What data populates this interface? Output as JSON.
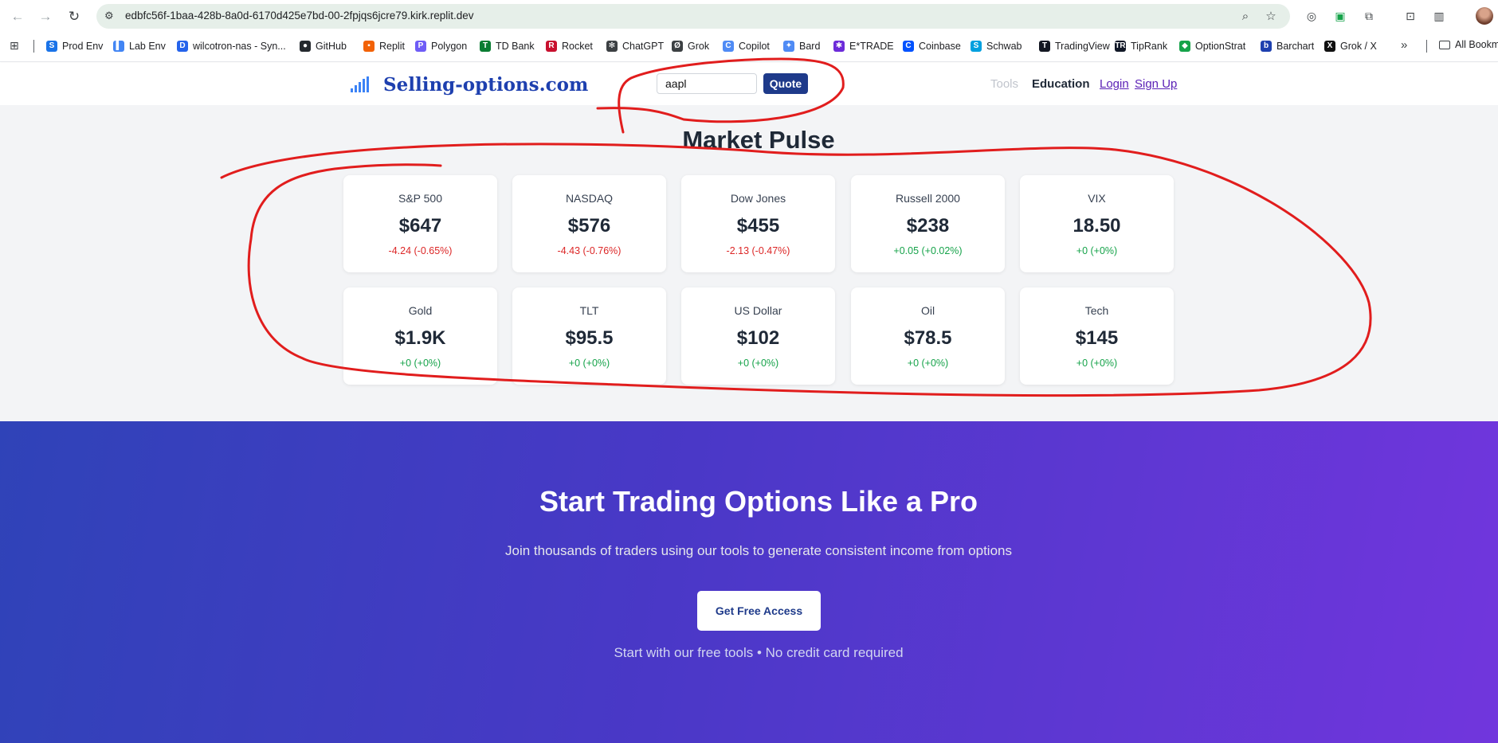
{
  "browser": {
    "url": "edbfc56f-1baa-428b-8a0d-6170d425e7bd-00-2fpjqs6jcre79.kirk.replit.dev",
    "bookmarks": [
      {
        "label": "Prod Env",
        "color": "#1a73e8",
        "glyph": "S"
      },
      {
        "label": "Lab Env",
        "color": "#4285f4",
        "glyph": "▌"
      },
      {
        "label": "wilcotron-nas - Syn...",
        "color": "#2563eb",
        "glyph": "D"
      },
      {
        "label": "GitHub",
        "color": "#24292e",
        "glyph": "●"
      },
      {
        "label": "Replit",
        "color": "#f26207",
        "glyph": "▪"
      },
      {
        "label": "Polygon",
        "color": "#6e5cf6",
        "glyph": "P"
      },
      {
        "label": "TD Bank",
        "color": "#0a7d32",
        "glyph": "T"
      },
      {
        "label": "Rocket",
        "color": "#c8102e",
        "glyph": "R"
      },
      {
        "label": "ChatGPT",
        "color": "#3c4043",
        "glyph": "✻"
      },
      {
        "label": "Grok",
        "color": "#3c4043",
        "glyph": "Ø"
      },
      {
        "label": "Copilot",
        "color": "#4f8bf5",
        "glyph": "C"
      },
      {
        "label": "Bard",
        "color": "#4f8bf5",
        "glyph": "✦"
      },
      {
        "label": "E*TRADE",
        "color": "#6c2bd9",
        "glyph": "✱"
      },
      {
        "label": "Coinbase",
        "color": "#0052ff",
        "glyph": "C"
      },
      {
        "label": "Schwab",
        "color": "#00a0df",
        "glyph": "S"
      },
      {
        "label": "TradingView",
        "color": "#131722",
        "glyph": "T"
      },
      {
        "label": "TipRank",
        "color": "#111827",
        "glyph": "TR"
      },
      {
        "label": "OptionStrat",
        "color": "#16a34a",
        "glyph": "◆"
      },
      {
        "label": "Barchart",
        "color": "#1e40af",
        "glyph": "b"
      },
      {
        "label": "Grok / X",
        "color": "#111111",
        "glyph": "X"
      }
    ],
    "bookmark_folder": "All Bookm",
    "more_bookmarks": "»"
  },
  "header": {
    "logo_text": "Selling-options.com",
    "search_value": "aapl",
    "quote_label": "Quote",
    "nav": {
      "tools": "Tools",
      "education": "Education",
      "login": "Login",
      "signup": "Sign Up"
    }
  },
  "market": {
    "title": "Market Pulse",
    "cards": [
      {
        "name": "S&P 500",
        "value": "$647",
        "change": "-4.24 (-0.65%)",
        "dir": "neg"
      },
      {
        "name": "NASDAQ",
        "value": "$576",
        "change": "-4.43 (-0.76%)",
        "dir": "neg"
      },
      {
        "name": "Dow Jones",
        "value": "$455",
        "change": "-2.13 (-0.47%)",
        "dir": "neg"
      },
      {
        "name": "Russell 2000",
        "value": "$238",
        "change": "+0.05 (+0.02%)",
        "dir": "pos"
      },
      {
        "name": "VIX",
        "value": "18.50",
        "change": "+0 (+0%)",
        "dir": "pos"
      },
      {
        "name": "Gold",
        "value": "$1.9K",
        "change": "+0 (+0%)",
        "dir": "pos"
      },
      {
        "name": "TLT",
        "value": "$95.5",
        "change": "+0 (+0%)",
        "dir": "pos"
      },
      {
        "name": "US Dollar",
        "value": "$102",
        "change": "+0 (+0%)",
        "dir": "pos"
      },
      {
        "name": "Oil",
        "value": "$78.5",
        "change": "+0 (+0%)",
        "dir": "pos"
      },
      {
        "name": "Tech",
        "value": "$145",
        "change": "+0 (+0%)",
        "dir": "pos"
      }
    ]
  },
  "cta": {
    "title": "Start Trading Options Like a Pro",
    "subtitle": "Join thousands of traders using our tools to generate consistent income from options",
    "button": "Get Free Access",
    "note": "Start with our free tools • No credit card required"
  },
  "colors": {
    "brand": "#1e40af",
    "annotation": "#e11d1d",
    "negative": "#dc2626",
    "positive": "#16a34a"
  }
}
